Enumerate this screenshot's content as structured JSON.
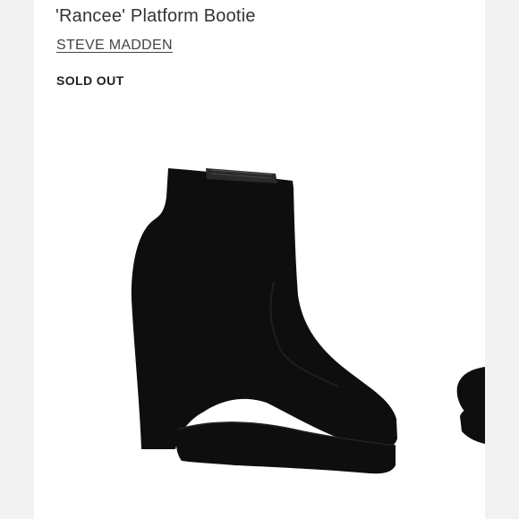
{
  "product": {
    "title": "'Rancee' Platform Bootie",
    "brand": "STEVE MADDEN",
    "status": "SOLD OUT"
  },
  "image": {
    "subject": "boot-image",
    "color": "#0d0d0d"
  },
  "colors": {
    "page_background": "#f2f2f2",
    "card_background": "#ffffff",
    "text_primary": "#333333"
  }
}
